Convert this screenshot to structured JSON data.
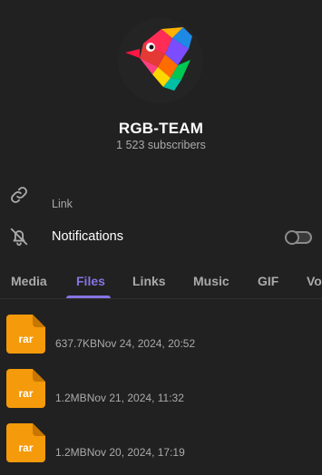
{
  "channel": {
    "title": "RGB-TEAM",
    "subscribers": "1 523 subscribers",
    "avatar_icon": "colorful-bird-logo"
  },
  "info": {
    "link_label": "Link",
    "link_icon": "link-icon",
    "notifications_label": "Notifications",
    "notifications_icon": "bell-off-icon",
    "notifications_enabled": false
  },
  "tabs": [
    {
      "label": "Media",
      "active": false
    },
    {
      "label": "Files",
      "active": true
    },
    {
      "label": "Links",
      "active": false
    },
    {
      "label": "Music",
      "active": false
    },
    {
      "label": "GIF",
      "active": false
    },
    {
      "label": "Voice",
      "active": false
    }
  ],
  "files": [
    {
      "ext": "rar",
      "size": "637.7KB",
      "date": "Nov 24, 2024, 20:52"
    },
    {
      "ext": "rar",
      "size": "1.2MB",
      "date": "Nov 21, 2024, 11:32"
    },
    {
      "ext": "rar",
      "size": "1.2MB",
      "date": "Nov 20, 2024, 17:19"
    }
  ],
  "colors": {
    "background": "#212121",
    "accent": "#8774e1",
    "file_icon": "#f59a0b",
    "muted_text": "#aaaaaa"
  }
}
